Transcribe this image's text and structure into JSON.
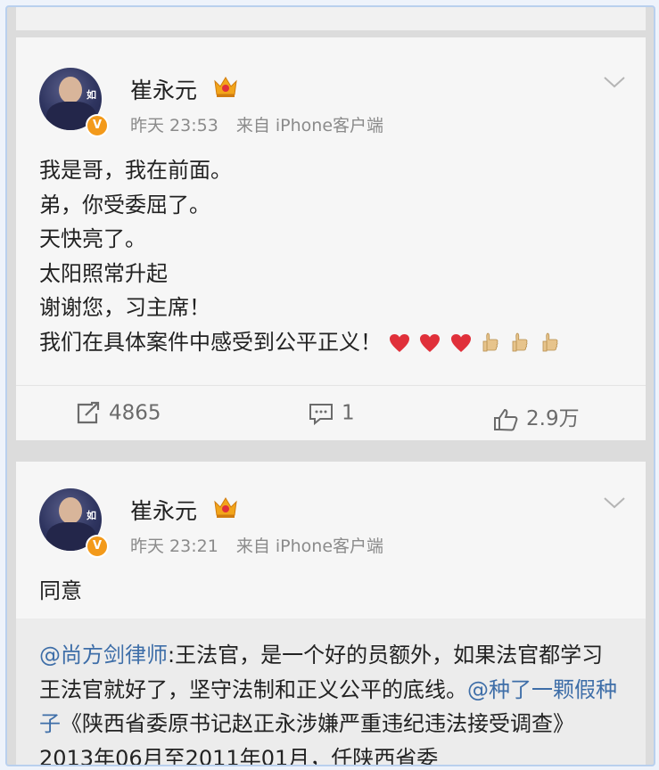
{
  "posts": [
    {
      "author": "崔永元",
      "time": "昨天 23:53",
      "source": "来自 iPhone客户端",
      "lines": [
        "我是哥，我在前面。",
        "弟，你受委屈了。",
        "天快亮了。",
        "太阳照常升起",
        "谢谢您，习主席！",
        "我们在具体案件中感受到公平正义！"
      ],
      "emojis": [
        "heart",
        "heart",
        "heart",
        "thumbs-up",
        "thumbs-up",
        "thumbs-up"
      ],
      "actions": {
        "repost": "4865",
        "comment": "1",
        "like": "2.9万"
      }
    },
    {
      "author": "崔永元",
      "time": "昨天 23:21",
      "source": "来自 iPhone客户端",
      "text": "同意",
      "quoted": {
        "mention1": "@尚方剑律师",
        "part1": ":王法官，是一个好的员额外，如果法官都学习王法官就好了，坚守法制和正义公平的底线。",
        "mention2": "@种了一颗假种子",
        "part2": "《陕西省委原书记赵正永涉嫌严重违纪违法接受调查》2013年06月至2011年01月，任陕西省委"
      }
    }
  ],
  "colors": {
    "link": "#3e6ea8",
    "badge": "#f39a1b",
    "heart": "#e0303a",
    "crown": "#f2a51b"
  },
  "icons": {
    "avatar_badge": "v-badge-icon",
    "crown": "crown-icon",
    "menu": "chevron-down-icon"
  }
}
